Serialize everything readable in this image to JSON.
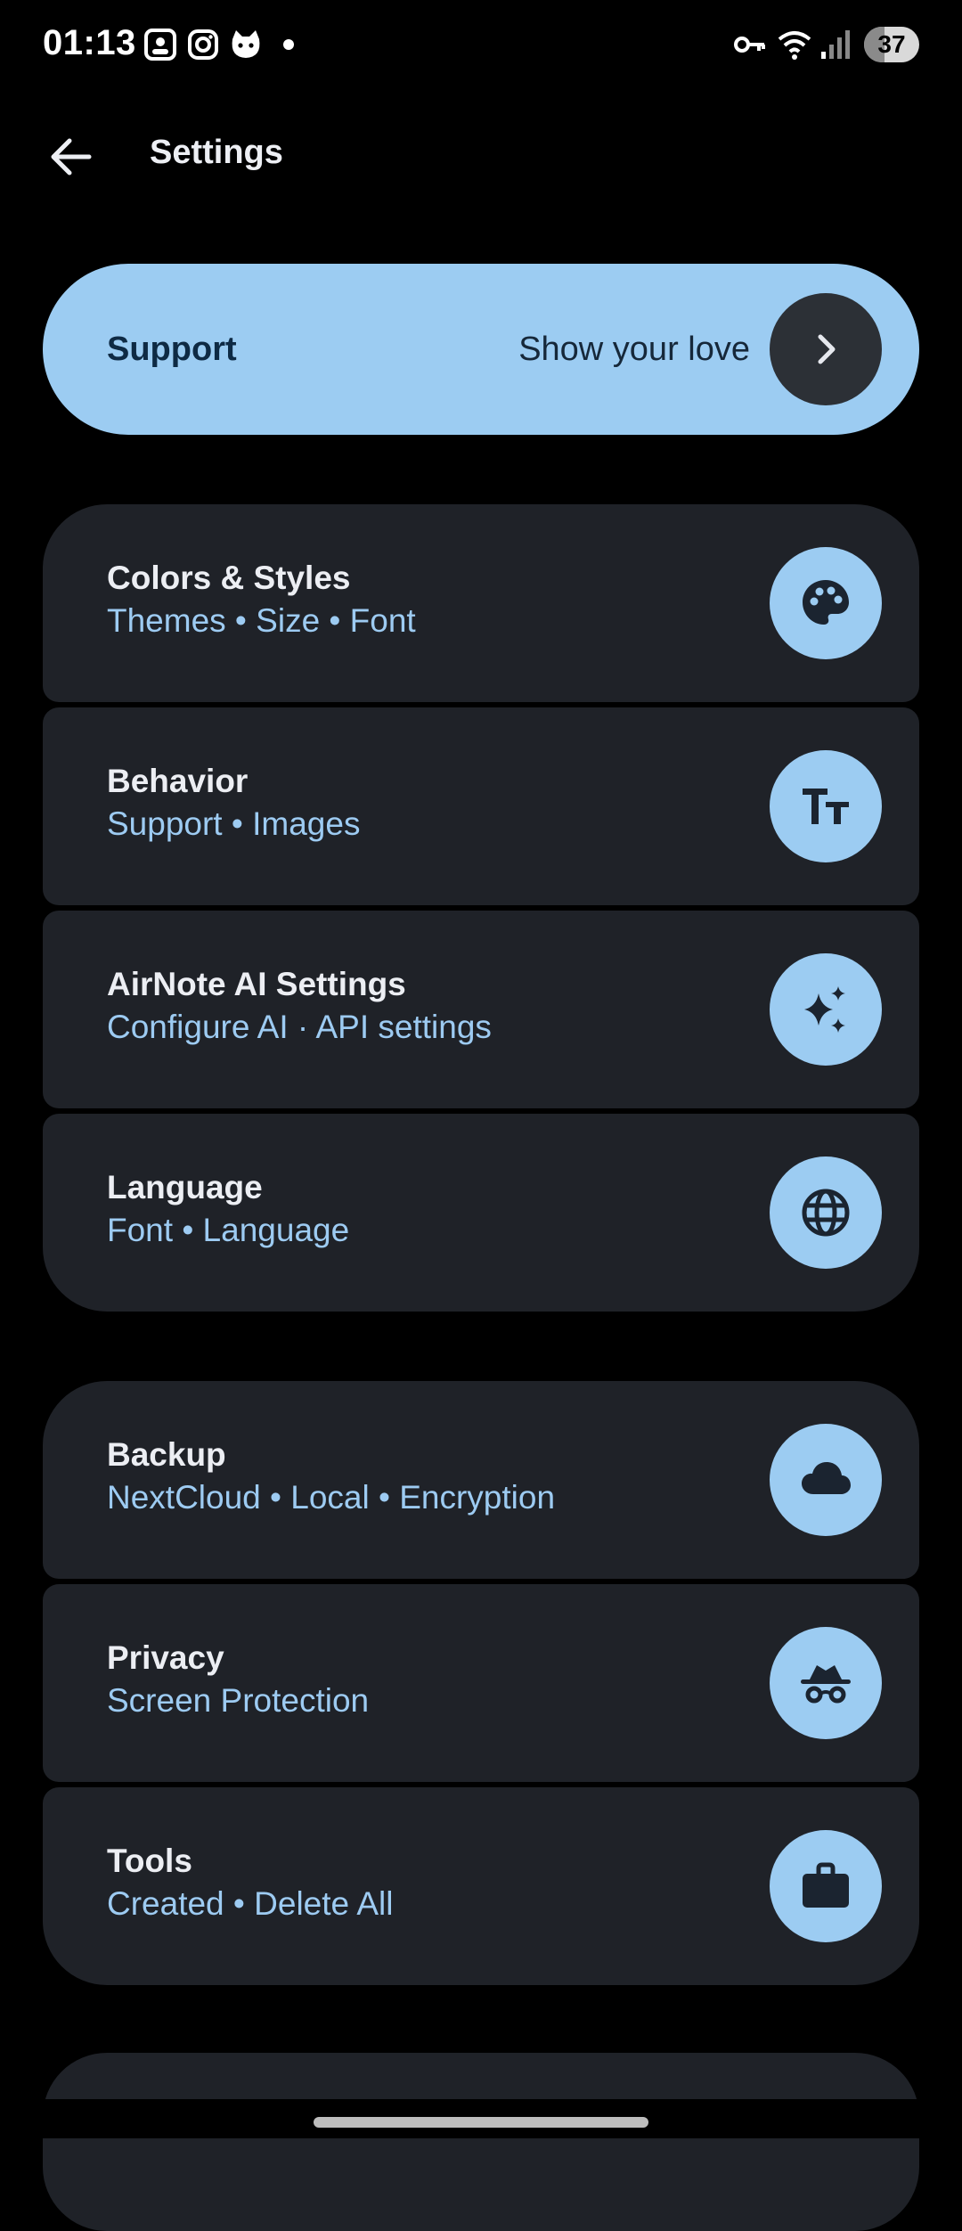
{
  "status_bar": {
    "time": "01:13",
    "battery": "37",
    "battery_level_percent": 37,
    "icons": [
      "face-scan-icon",
      "instagram-icon",
      "cat-app-icon",
      "notification-dot",
      "vpn-key-icon",
      "wifi-icon",
      "cell-signal-icon",
      "battery-icon"
    ]
  },
  "app_bar": {
    "back_icon": "arrow-left-icon",
    "title": "Settings"
  },
  "support": {
    "title": "Support",
    "subtitle": "Show your love",
    "icon": "chevron-right-icon"
  },
  "groups": [
    {
      "items": [
        {
          "title": "Colors & Styles",
          "subtitle": "Themes • Size • Font",
          "icon": "palette-icon"
        },
        {
          "title": "Behavior",
          "subtitle": "Support • Images",
          "icon": "text-size-icon"
        },
        {
          "title": "AirNote AI Settings",
          "subtitle": "Configure AI · API settings",
          "icon": "sparkle-icon"
        },
        {
          "title": "Language",
          "subtitle": "Font • Language",
          "icon": "globe-icon"
        }
      ]
    },
    {
      "items": [
        {
          "title": "Backup",
          "subtitle": "NextCloud • Local • Encryption",
          "icon": "cloud-icon"
        },
        {
          "title": "Privacy",
          "subtitle": "Screen Protection",
          "icon": "incognito-icon"
        },
        {
          "title": "Tools",
          "subtitle": "Created • Delete All",
          "icon": "briefcase-icon"
        }
      ]
    }
  ],
  "colors": {
    "background": "#000000",
    "card": "#1F2228",
    "accent": "#9CCCF2",
    "subtitle": "#9DCBF2",
    "icon_glyph": "#1B2430"
  }
}
